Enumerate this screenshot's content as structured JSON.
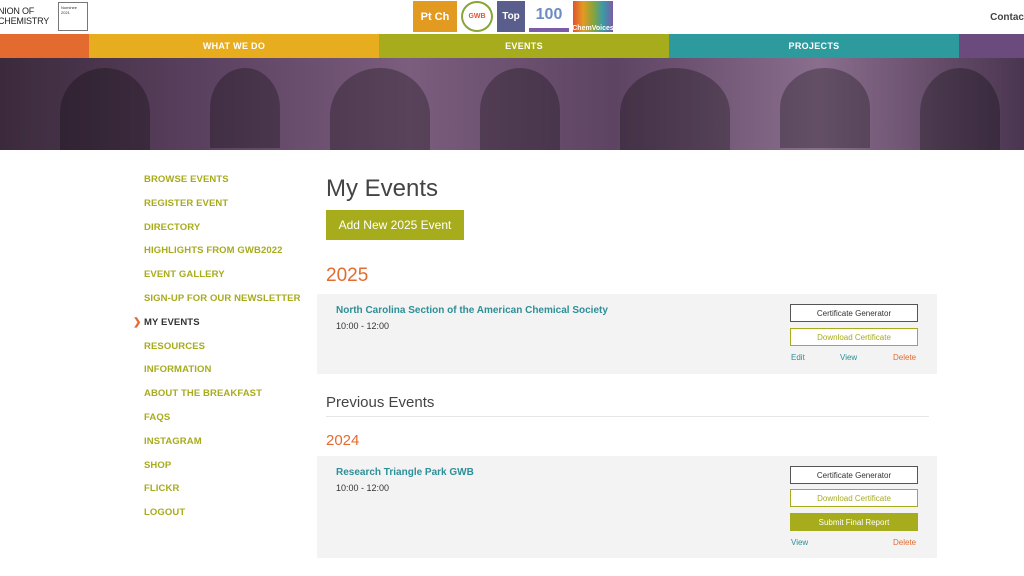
{
  "header": {
    "brand_line1": "NION OF",
    "brand_line2": "CHEMISTRY",
    "badge_text": "Nominee 2021",
    "logos": [
      "Pt Ch",
      "GWB",
      "Top",
      "100",
      "ChemVoices"
    ],
    "contact": "Contac"
  },
  "nav": {
    "items": [
      "WHAT WE DO",
      "EVENTS",
      "PROJECTS"
    ]
  },
  "sidebar": {
    "items": [
      "BROWSE EVENTS",
      "REGISTER EVENT",
      "DIRECTORY",
      "HIGHLIGHTS FROM GWB2022",
      "EVENT GALLERY",
      "SIGN-UP FOR OUR NEWSLETTER",
      "MY EVENTS",
      "RESOURCES",
      "INFORMATION",
      "ABOUT THE BREAKFAST",
      "FAQS",
      "INSTAGRAM",
      "SHOP",
      "FLICKR",
      "LOGOUT"
    ]
  },
  "main": {
    "title": "My Events",
    "add_button": "Add New 2025 Event",
    "current_year": "2025",
    "current_event": {
      "title": "North Carolina Section of the American Chemical Society",
      "time": "10:00 - 12:00",
      "cert_generator": "Certificate Generator",
      "download_cert": "Download Certificate",
      "edit": "Edit",
      "view": "View",
      "delete": "Delete"
    },
    "previous_title": "Previous Events",
    "previous_year": "2024",
    "previous_event": {
      "title": "Research Triangle Park GWB",
      "time": "10:00 - 12:00",
      "cert_generator": "Certificate Generator",
      "download_cert": "Download Certificate",
      "submit_report": "Submit Final Report",
      "view": "View",
      "delete": "Delete"
    }
  },
  "colors": {
    "olive": "#a7ac1c",
    "orange": "#e36b2f",
    "teal": "#2d8f97"
  }
}
